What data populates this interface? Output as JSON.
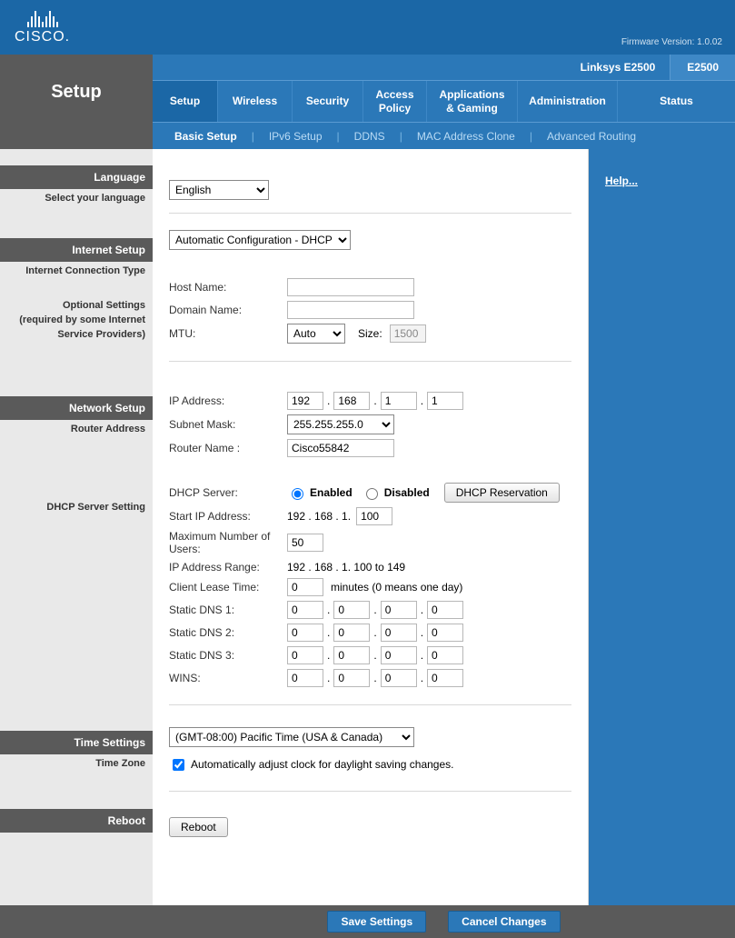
{
  "firmware_label": "Firmware Version: 1.0.02",
  "cisco": "CISCO.",
  "page_title": "Setup",
  "model_name": "Linksys E2500",
  "model_badge": "E2500",
  "main_tabs": [
    "Setup",
    "Wireless",
    "Security",
    "Access Policy",
    "Applications & Gaming",
    "Administration",
    "Status"
  ],
  "sub_tabs": [
    "Basic Setup",
    "IPv6 Setup",
    "DDNS",
    "MAC Address Clone",
    "Advanced Routing"
  ],
  "sections": {
    "language_hdr": "Language",
    "language_sub": "Select your language",
    "internet_hdr": "Internet Setup",
    "internet_sub1": "Internet Connection Type",
    "internet_sub2_l1": "Optional Settings",
    "internet_sub2_l2": "(required by some Internet",
    "internet_sub2_l3": "Service Providers)",
    "network_hdr": "Network Setup",
    "network_sub1": "Router Address",
    "network_sub2": "DHCP Server Setting",
    "time_hdr": "Time Settings",
    "time_sub": "Time Zone",
    "reboot_hdr": "Reboot"
  },
  "language": {
    "value": "English"
  },
  "internet": {
    "conn_type": "Automatic Configuration - DHCP",
    "host_label": "Host Name:",
    "host_value": "",
    "domain_label": "Domain Name:",
    "domain_value": "",
    "mtu_label": "MTU:",
    "mtu_value": "Auto",
    "size_label": "Size:",
    "size_value": "1500"
  },
  "router": {
    "ip_label": "IP Address:",
    "ip": [
      "192",
      "168",
      "1",
      "1"
    ],
    "mask_label": "Subnet Mask:",
    "mask_value": "255.255.255.0",
    "name_label": "Router Name :",
    "name_value": "Cisco55842"
  },
  "dhcp": {
    "server_label": "DHCP Server:",
    "enabled_label": "Enabled",
    "disabled_label": "Disabled",
    "reservation_btn": "DHCP Reservation",
    "start_label": "Start IP Address:",
    "start_prefix": "192 . 168 . 1.",
    "start_value": "100",
    "max_label": "Maximum Number of Users:",
    "max_value": "50",
    "range_label": "IP Address Range:",
    "range_value": "192 . 168 . 1. 100 to 149",
    "lease_label": "Client Lease Time:",
    "lease_value": "0",
    "lease_suffix": "minutes (0 means one day)",
    "dns1_label": "Static DNS 1:",
    "dns2_label": "Static DNS 2:",
    "dns3_label": "Static DNS 3:",
    "wins_label": "WINS:",
    "zero": "0"
  },
  "time": {
    "tz_value": "(GMT-08:00) Pacific Time (USA & Canada)",
    "dst_label": "Automatically adjust clock for daylight saving changes."
  },
  "reboot_btn": "Reboot",
  "help_link": "Help...",
  "footer": {
    "save": "Save Settings",
    "cancel": "Cancel Changes"
  }
}
